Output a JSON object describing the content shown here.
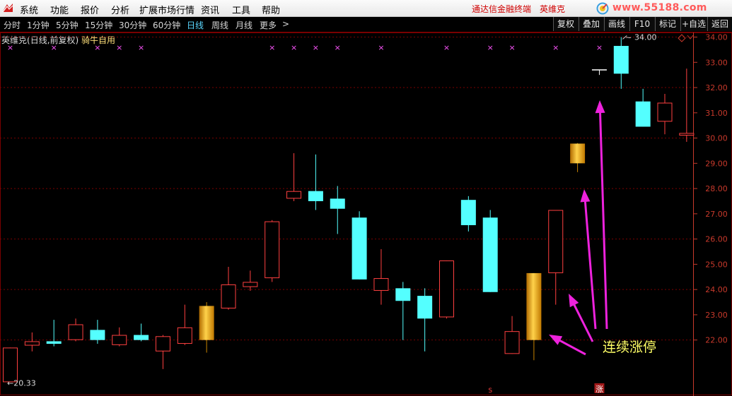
{
  "menu": {
    "items": [
      "系统",
      "功能",
      "报价",
      "分析",
      "扩展市场行情",
      "资讯",
      "工具",
      "帮助"
    ],
    "app_name": "通达信金融终端",
    "stock_name": "英维克",
    "site": "www.55188.com"
  },
  "periods": {
    "items": [
      "分时",
      "1分钟",
      "5分钟",
      "15分钟",
      "30分钟",
      "60分钟",
      "日线",
      "周线",
      "月线",
      "更多"
    ],
    "active": "日线",
    "more_arrow": ">"
  },
  "toolbar": {
    "items": [
      "复权",
      "叠加",
      "画线",
      "F10",
      "标记",
      "+自选",
      "返回"
    ]
  },
  "chart_title": {
    "stock": "英维克",
    "mode": "(日线,前复权)",
    "indicator": "骑牛自用"
  },
  "colors": {
    "up": "#ff4040",
    "down": "#54ffff",
    "limit_up": "#ffb000",
    "axis": "#c8392b",
    "grid": "#7a0000",
    "marker": "#ff55ff",
    "arrow": "#ee22dd",
    "annotation": "#ffff66"
  },
  "chart_data": {
    "type": "candlestick",
    "ylim": [
      19.95,
      34.35
    ],
    "yticks": [
      22.0,
      23.0,
      24.0,
      25.0,
      26.0,
      27.0,
      28.0,
      29.0,
      30.0,
      31.0,
      32.0,
      33.0,
      34.0
    ],
    "ytick_labels": [
      "22.00",
      "23.00",
      "24.00",
      "25.00",
      "26.00",
      "27.00",
      "28.00",
      "29.00",
      "30.00",
      "31.00",
      "32.00",
      "33.00",
      "34.00"
    ],
    "dashed_gridlines": [
      22.0,
      24.0,
      26.0,
      28.0,
      30.0,
      32.0,
      34.0
    ],
    "candles": [
      {
        "o": 20.33,
        "h": 21.7,
        "l": 20.33,
        "c": 21.7,
        "k": "up"
      },
      {
        "o": 21.78,
        "h": 22.3,
        "l": 21.55,
        "c": 21.95,
        "k": "up"
      },
      {
        "o": 21.95,
        "h": 22.8,
        "l": 21.75,
        "c": 21.85,
        "k": "down"
      },
      {
        "o": 22.0,
        "h": 22.85,
        "l": 21.95,
        "c": 22.62,
        "k": "up"
      },
      {
        "o": 22.4,
        "h": 22.8,
        "l": 21.85,
        "c": 22.0,
        "k": "down"
      },
      {
        "o": 21.8,
        "h": 22.5,
        "l": 21.75,
        "c": 22.2,
        "k": "up"
      },
      {
        "o": 22.2,
        "h": 22.65,
        "l": 21.95,
        "c": 22.0,
        "k": "down"
      },
      {
        "o": 21.55,
        "h": 22.2,
        "l": 20.85,
        "c": 22.15,
        "k": "up"
      },
      {
        "o": 21.85,
        "h": 23.4,
        "l": 21.8,
        "c": 22.5,
        "k": "up"
      },
      {
        "o": 22.0,
        "h": 23.5,
        "l": 21.5,
        "c": 23.35,
        "k": "limit"
      },
      {
        "o": 23.25,
        "h": 24.9,
        "l": 23.2,
        "c": 24.2,
        "k": "up"
      },
      {
        "o": 24.1,
        "h": 24.75,
        "l": 23.95,
        "c": 24.3,
        "k": "up"
      },
      {
        "o": 24.45,
        "h": 26.75,
        "l": 24.3,
        "c": 26.7,
        "k": "up"
      },
      {
        "o": 27.6,
        "h": 29.4,
        "l": 27.5,
        "c": 27.9,
        "k": "up"
      },
      {
        "o": 27.9,
        "h": 29.35,
        "l": 27.15,
        "c": 27.5,
        "k": "down"
      },
      {
        "o": 27.6,
        "h": 28.1,
        "l": 26.2,
        "c": 27.2,
        "k": "down"
      },
      {
        "o": 26.85,
        "h": 27.1,
        "l": 24.4,
        "c": 24.4,
        "k": "down"
      },
      {
        "o": 23.95,
        "h": 25.6,
        "l": 23.4,
        "c": 24.45,
        "k": "up"
      },
      {
        "o": 24.05,
        "h": 24.3,
        "l": 22.0,
        "c": 23.55,
        "k": "down"
      },
      {
        "o": 23.75,
        "h": 24.05,
        "l": 21.55,
        "c": 22.85,
        "k": "down"
      },
      {
        "o": 22.9,
        "h": 25.15,
        "l": 22.85,
        "c": 25.15,
        "k": "up"
      },
      {
        "o": 27.55,
        "h": 27.7,
        "l": 26.3,
        "c": 26.55,
        "k": "down"
      },
      {
        "o": 26.85,
        "h": 27.15,
        "l": 23.9,
        "c": 23.9,
        "k": "down"
      },
      {
        "o": 21.45,
        "h": 22.95,
        "l": 21.45,
        "c": 22.35,
        "k": "up"
      },
      {
        "o": 22.0,
        "h": 24.65,
        "l": 21.2,
        "c": 24.65,
        "k": "limit"
      },
      {
        "o": 24.65,
        "h": 27.15,
        "l": 23.4,
        "c": 27.15,
        "k": "up"
      },
      {
        "o": 29.0,
        "h": 29.8,
        "l": 28.65,
        "c": 29.78,
        "k": "limit"
      },
      {
        "o": 32.7,
        "h": 32.7,
        "l": 32.5,
        "c": 32.7,
        "k": "flat"
      },
      {
        "o": 32.55,
        "h": 34.0,
        "l": 31.95,
        "c": 33.65,
        "k": "down"
      },
      {
        "o": 31.45,
        "h": 31.95,
        "l": 30.45,
        "c": 30.45,
        "k": "down"
      },
      {
        "o": 30.65,
        "h": 31.75,
        "l": 30.15,
        "c": 31.4,
        "k": "up"
      },
      {
        "o": 30.1,
        "h": 32.75,
        "l": 29.85,
        "c": 30.2,
        "k": "up"
      }
    ],
    "top_marker_indices": [
      0,
      2,
      4,
      5,
      6,
      12,
      13,
      14,
      15,
      17,
      20,
      22,
      23,
      25,
      27
    ],
    "marker_glyph": "×",
    "low_label": "←20.33",
    "high_label": "←34.00",
    "annotation": "连续涨停",
    "bottom_tags": [
      {
        "index": 22,
        "text": "S"
      },
      {
        "index": 27,
        "text": "涨"
      }
    ]
  }
}
